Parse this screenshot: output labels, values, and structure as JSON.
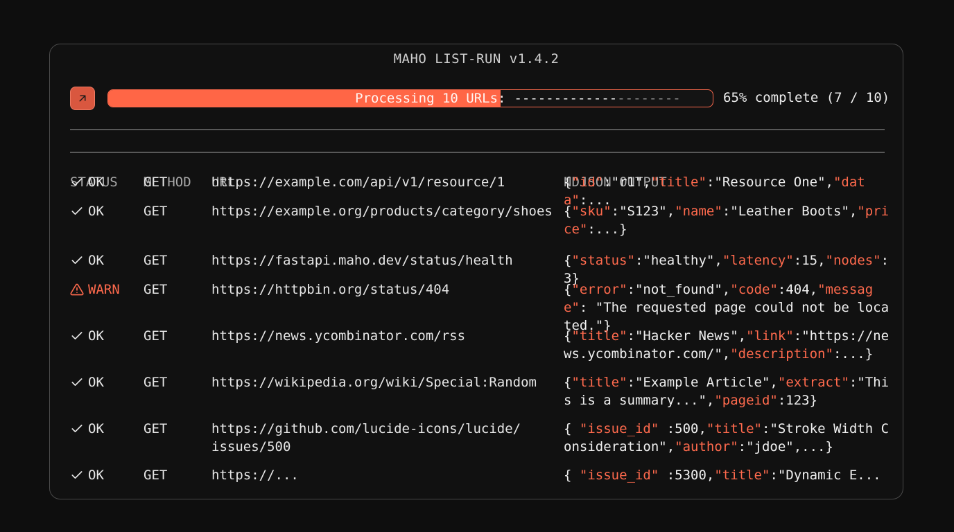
{
  "app": {
    "title": "MAHO LIST-RUN v1.4.2"
  },
  "progress": {
    "label": "Processing 10 URLs:",
    "fraction": 0.65,
    "dashes_done": "-------------",
    "dashes_left": "--------",
    "percent_text": "65% complete (7 / 10)"
  },
  "table": {
    "headers": {
      "status": "STATUS",
      "method": "METHOD",
      "url": "URL",
      "output": "NDJSON OUTPUT"
    },
    "rows": [
      {
        "status": "OK",
        "level": "ok",
        "method": "GET",
        "url": "https://example.com/api/v1/resource/1",
        "output": [
          [
            "{",
            0
          ],
          [
            "\"id\"",
            1
          ],
          [
            ":\"r1\",",
            0
          ],
          [
            "\"title\"",
            1
          ],
          [
            ":\"Resource One\",",
            0
          ],
          [
            "\"data\"",
            1
          ],
          [
            ":...",
            0
          ]
        ]
      },
      {
        "status": "OK",
        "level": "ok",
        "method": "GET",
        "url": "https://example.org/products/category/shoes",
        "output": [
          [
            "{",
            0
          ],
          [
            "\"sku\"",
            1
          ],
          [
            ":\"S123\",",
            0
          ],
          [
            "\"name\"",
            1
          ],
          [
            ":\"Leather Boots\",",
            0
          ],
          [
            "\"price\"",
            1
          ],
          [
            ":...}",
            0
          ]
        ]
      },
      {
        "status": "OK",
        "level": "ok",
        "method": "GET",
        "url": "https://fastapi.maho.dev/status/health",
        "output": [
          [
            "{",
            0
          ],
          [
            "\"status\"",
            1
          ],
          [
            ":\"healthy\",",
            0
          ],
          [
            "\"latency\"",
            1
          ],
          [
            ":15,",
            0
          ],
          [
            "\"nodes\"",
            1
          ],
          [
            ":3}",
            0
          ]
        ]
      },
      {
        "status": "WARN",
        "level": "warn",
        "method": "GET",
        "url": "https://httpbin.org/status/404",
        "output": [
          [
            "{",
            0
          ],
          [
            "\"error\"",
            1
          ],
          [
            ":\"not_found\",",
            0
          ],
          [
            "\"code\"",
            1
          ],
          [
            ":404,",
            0
          ],
          [
            "\"message\"",
            1
          ],
          [
            ": \"The requested page could not be located.\"}",
            0
          ]
        ]
      },
      {
        "status": "OK",
        "level": "ok",
        "method": "GET",
        "url": "https://news.ycombinator.com/rss",
        "output": [
          [
            "{",
            0
          ],
          [
            "\"title\"",
            1
          ],
          [
            ":\"Hacker News\",",
            0
          ],
          [
            "\"link\"",
            1
          ],
          [
            ":\"https://news.ycombinator.com/\",",
            0
          ],
          [
            "\"description\"",
            1
          ],
          [
            ":...}",
            0
          ]
        ]
      },
      {
        "status": "OK",
        "level": "ok",
        "method": "GET",
        "url": "https://wikipedia.org/wiki/Special:Random",
        "output": [
          [
            "{",
            0
          ],
          [
            "\"title\"",
            1
          ],
          [
            ":\"Example Article\",",
            0
          ],
          [
            "\"extract\"",
            1
          ],
          [
            ":\"This is a summary...\",",
            0
          ],
          [
            "\"pageid\"",
            1
          ],
          [
            ":123}",
            0
          ]
        ]
      },
      {
        "status": "OK",
        "level": "ok",
        "method": "GET",
        "url": "https://github.com/lucide-icons/lucide/\nissues/500",
        "output": [
          [
            "{ ",
            0
          ],
          [
            "\"issue_id\"",
            1
          ],
          [
            " :500,",
            0
          ],
          [
            "\"title\"",
            1
          ],
          [
            ":\"Stroke Width Consideration\",",
            0
          ],
          [
            "\"author\"",
            1
          ],
          [
            ":\"jdoe\",...}",
            0
          ]
        ]
      },
      {
        "status": "OK",
        "level": "ok",
        "method": "GET",
        "url": "https://...",
        "output": [
          [
            "{ ",
            0
          ],
          [
            "\"issue_id\"",
            1
          ],
          [
            " :5300,",
            0
          ],
          [
            "\"title\"",
            1
          ],
          [
            ":\"Dynamic E...",
            0
          ]
        ]
      }
    ]
  },
  "colors": {
    "accent": "#ff6646",
    "panel_border": "#4a4a4a",
    "background": "#0e0e0e"
  },
  "icons": {
    "expand": "arrow-up-right-icon",
    "ok": "check-icon",
    "warn": "alert-triangle-icon"
  }
}
